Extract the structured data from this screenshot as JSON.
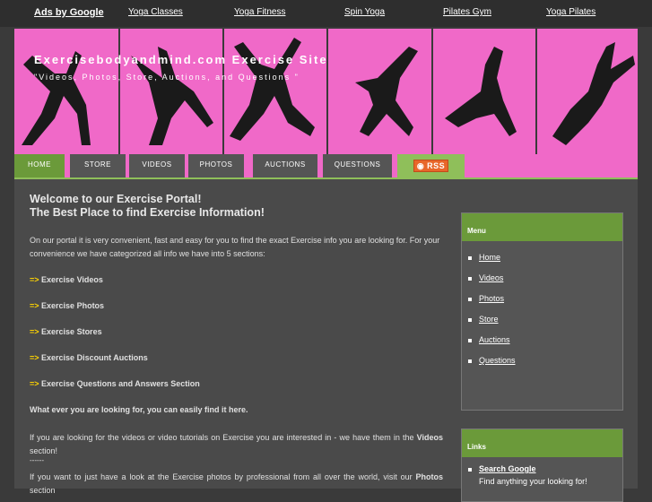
{
  "ads": {
    "label": "Ads by Google",
    "links": [
      "Yoga Classes",
      "Yoga Fitness",
      "Spin Yoga",
      "Pilates Gym",
      "Yoga Pilates"
    ]
  },
  "header": {
    "title": "Exercisebodyandmind.com Exercise Site",
    "subtitle": "\"Videos, Photos, Store, Auctions, and Questions \""
  },
  "nav": {
    "items": [
      "HOME",
      "STORE",
      "VIDEOS",
      "PHOTOS",
      "AUCTIONS",
      "QUESTIONS"
    ],
    "rss": "RSS"
  },
  "main": {
    "heading1": "Welcome to our Exercise Portal!",
    "heading2": "The Best Place to find Exercise Information!",
    "intro": "On our portal it is very convenient, fast and easy for you to find the exact Exercise info you are looking for. For your convenience we have categorized all info we have into 5 sections:",
    "arrow": "=>",
    "sections": [
      "Exercise Videos",
      "Exercise Photos",
      "Exercise Stores",
      "Exercise Discount Auctions",
      "Exercise Questions and Answers Section"
    ],
    "whatever": "What ever you are looking for, you can easily find it here.",
    "videos_text": "If you are looking for the videos or video tutorials on Exercise you are interested in - we have them in the",
    "videos_bold": "Videos",
    "videos_tail": "section!",
    "photos_text": "If you want to just have a look at the Exercise photos by professional from all over the world, visit our",
    "photos_bold": "Photos",
    "photos_tail": "section"
  },
  "sidebar": {
    "menu_title": "Menu",
    "menu_items": [
      "Home",
      "Videos",
      "Photos",
      "Store",
      "Auctions",
      "Questions"
    ],
    "links_title": "Links",
    "links_items": [
      "Search Google"
    ],
    "links_desc": "Find anything your looking for!"
  },
  "colors": {
    "accent": "#6b9a3a",
    "banner": "#f069c8",
    "arrow": "#ffd400"
  }
}
